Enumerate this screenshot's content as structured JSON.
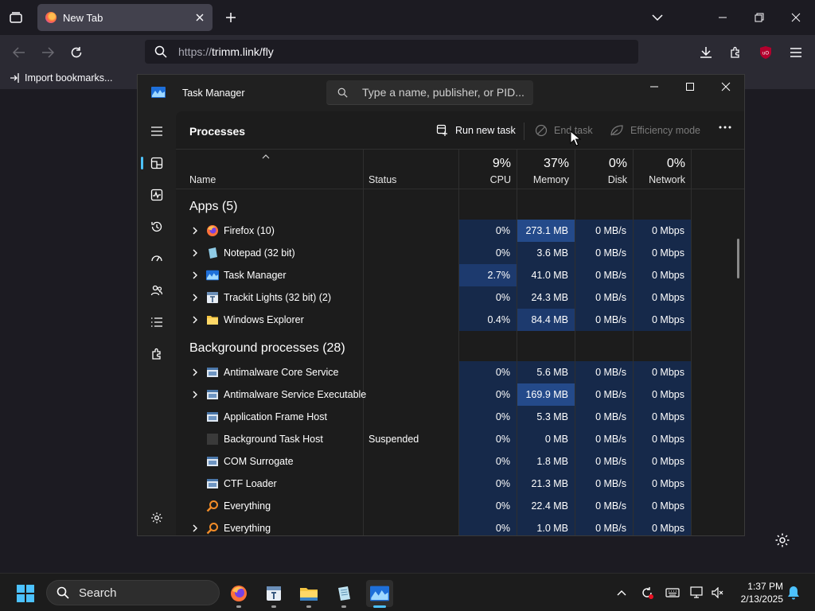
{
  "browser": {
    "tab_title": "New Tab",
    "url_protocol": "https://",
    "url_host": "trimm.link/fly",
    "bookmark_item": "Import bookmarks..."
  },
  "task_manager": {
    "title": "Task Manager",
    "search_placeholder": "Type a name, publisher, or PID...",
    "page_title": "Processes",
    "toolbar": {
      "run_new_task": "Run new task",
      "end_task": "End task",
      "efficiency_mode": "Efficiency mode"
    },
    "columns": {
      "name": "Name",
      "status": "Status",
      "cpu_pct": "9%",
      "cpu": "CPU",
      "memory_pct": "37%",
      "memory": "Memory",
      "disk_pct": "0%",
      "disk": "Disk",
      "network_pct": "0%",
      "network": "Network"
    },
    "groups": {
      "apps": "Apps (5)",
      "background": "Background processes (28)"
    },
    "apps": [
      {
        "name": "Firefox (10)",
        "status": "",
        "cpu": "0%",
        "memory": "273.1 MB",
        "disk": "0 MB/s",
        "network": "0 Mbps"
      },
      {
        "name": "Notepad (32 bit)",
        "status": "",
        "cpu": "0%",
        "memory": "3.6 MB",
        "disk": "0 MB/s",
        "network": "0 Mbps"
      },
      {
        "name": "Task Manager",
        "status": "",
        "cpu": "2.7%",
        "memory": "41.0 MB",
        "disk": "0 MB/s",
        "network": "0 Mbps"
      },
      {
        "name": "Trackit Lights (32 bit) (2)",
        "status": "",
        "cpu": "0%",
        "memory": "24.3 MB",
        "disk": "0 MB/s",
        "network": "0 Mbps"
      },
      {
        "name": "Windows Explorer",
        "status": "",
        "cpu": "0.4%",
        "memory": "84.4 MB",
        "disk": "0 MB/s",
        "network": "0 Mbps"
      }
    ],
    "background": [
      {
        "name": "Antimalware Core Service",
        "status": "",
        "cpu": "0%",
        "memory": "5.6 MB",
        "disk": "0 MB/s",
        "network": "0 Mbps"
      },
      {
        "name": "Antimalware Service Executable",
        "status": "",
        "cpu": "0%",
        "memory": "169.9 MB",
        "disk": "0 MB/s",
        "network": "0 Mbps"
      },
      {
        "name": "Application Frame Host",
        "status": "",
        "cpu": "0%",
        "memory": "5.3 MB",
        "disk": "0 MB/s",
        "network": "0 Mbps"
      },
      {
        "name": "Background Task Host",
        "status": "Suspended",
        "cpu": "0%",
        "memory": "0 MB",
        "disk": "0 MB/s",
        "network": "0 Mbps"
      },
      {
        "name": "COM Surrogate",
        "status": "",
        "cpu": "0%",
        "memory": "1.8 MB",
        "disk": "0 MB/s",
        "network": "0 Mbps"
      },
      {
        "name": "CTF Loader",
        "status": "",
        "cpu": "0%",
        "memory": "21.3 MB",
        "disk": "0 MB/s",
        "network": "0 Mbps"
      },
      {
        "name": "Everything",
        "status": "",
        "cpu": "0%",
        "memory": "22.4 MB",
        "disk": "0 MB/s",
        "network": "0 Mbps"
      },
      {
        "name": "Everything",
        "status": "",
        "cpu": "0%",
        "memory": "1.0 MB",
        "disk": "0 MB/s",
        "network": "0 Mbps"
      }
    ]
  },
  "taskbar": {
    "search_label": "Search",
    "time": "1:37 PM",
    "date": "2/13/2025"
  },
  "colors": {
    "accent": "#4cc2ff",
    "heat_light": "#16294a",
    "heat_medium": "#1d3a6e",
    "heat_strong": "#244a8a"
  }
}
